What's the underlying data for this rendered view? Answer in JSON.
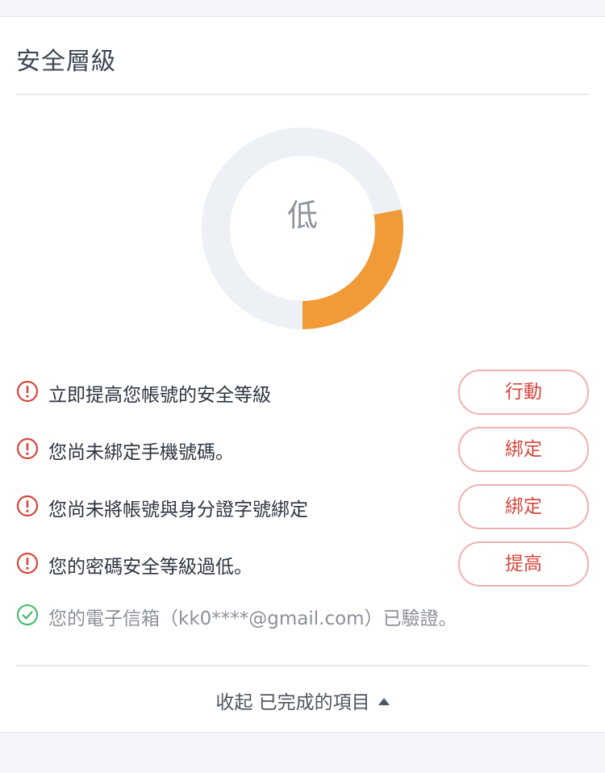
{
  "card": {
    "title": "安全層級"
  },
  "gauge": {
    "level_label": "低",
    "fill_fraction": 0.28,
    "fill_color": "#f19a38",
    "track_color": "#edf1f5"
  },
  "todo_items": [
    {
      "icon": "exclamation-circle-icon",
      "text": "立即提高您帳號的安全等級",
      "action": "行動"
    },
    {
      "icon": "exclamation-circle-icon",
      "text": "您尚未綁定手機號碼。",
      "action": "綁定"
    },
    {
      "icon": "exclamation-circle-icon",
      "text": "您尚未將帳號與身分證字號綁定",
      "action": "綁定"
    },
    {
      "icon": "exclamation-circle-icon",
      "text": "您的密碼安全等級過低。",
      "action": "提高"
    }
  ],
  "completed_items": [
    {
      "icon": "check-circle-icon",
      "text": "您的電子信箱（kk0****@gmail.com）已驗證。"
    }
  ],
  "collapse": {
    "label": "收起 已完成的項目",
    "icon": "caret-up-icon"
  },
  "colors": {
    "warning": "#d6463d",
    "success": "#3fba63",
    "button_border": "#efb2b0"
  }
}
